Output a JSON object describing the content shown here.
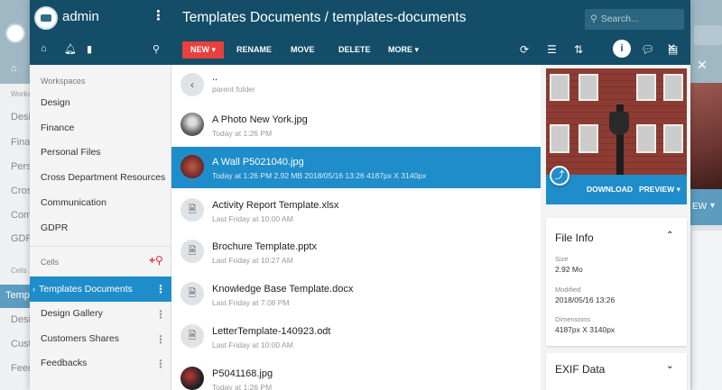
{
  "background": {
    "left_labels": [
      "Works",
      "Desig",
      "Finan",
      "Perso",
      "Cros",
      "Comm",
      "GDPR",
      "Cells",
      "Temp",
      "Desig",
      "Custo",
      "Feed"
    ],
    "right_preview_label": "EW"
  },
  "sidebar": {
    "username": "admin",
    "workspaces_heading": "Workspaces",
    "workspaces": [
      {
        "label": "Design"
      },
      {
        "label": "Finance"
      },
      {
        "label": "Personal Files"
      },
      {
        "label": "Cross Department Resources"
      },
      {
        "label": "Communication"
      },
      {
        "label": "GDPR"
      }
    ],
    "cells_heading": "Cells",
    "cells": [
      {
        "label": "Templates Documents",
        "selected": true
      },
      {
        "label": "Design Gallery"
      },
      {
        "label": "Customers Shares"
      },
      {
        "label": "Feedbacks"
      }
    ]
  },
  "header": {
    "title": "Templates Documents / templates-documents",
    "search_placeholder": "Search...",
    "toolbar": {
      "new_label": "NEW",
      "rename_label": "RENAME",
      "move_label": "MOVE",
      "delete_label": "DELETE",
      "more_label": "MORE"
    }
  },
  "files": [
    {
      "name": "..",
      "meta": "parent folder",
      "kind": "parent"
    },
    {
      "name": "A Photo New York.jpg",
      "meta": "Today at 1:26 PM",
      "kind": "photo"
    },
    {
      "name": "A Wall P5021040.jpg",
      "meta": "Today at 1:26 PM  2.92 MB  2018/05/16 13:26    4187px X 3140px",
      "kind": "wall",
      "selected": true
    },
    {
      "name": "Activity Report Template.xlsx",
      "meta": "Last Friday at 10:00 AM",
      "kind": "doc"
    },
    {
      "name": "Brochure Template.pptx",
      "meta": "Last Friday at 10:27 AM",
      "kind": "doc"
    },
    {
      "name": "Knowledge Base Template.docx",
      "meta": "Last Friday at 7:08 PM",
      "kind": "doc"
    },
    {
      "name": "LetterTemplate-140923.odt",
      "meta": "Last Friday at 10:00 AM",
      "kind": "doc"
    },
    {
      "name": "P5041168.jpg",
      "meta": "Today at 1:26 PM",
      "kind": "dark"
    }
  ],
  "details": {
    "download_label": "DOWNLOAD",
    "preview_label": "PREVIEW",
    "file_info": {
      "title": "File Info",
      "size_label": "Size",
      "size_value": "2.92 Mo",
      "modified_label": "Modified",
      "modified_value": "2018/05/16 13:26",
      "dimensions_label": "Dimensions",
      "dimensions_value": "4187px X 3140px"
    },
    "exif_title": "EXIF Data"
  },
  "colors": {
    "header": "#134d68",
    "accent": "#1f8dc9",
    "new_button": "#e8403d"
  }
}
